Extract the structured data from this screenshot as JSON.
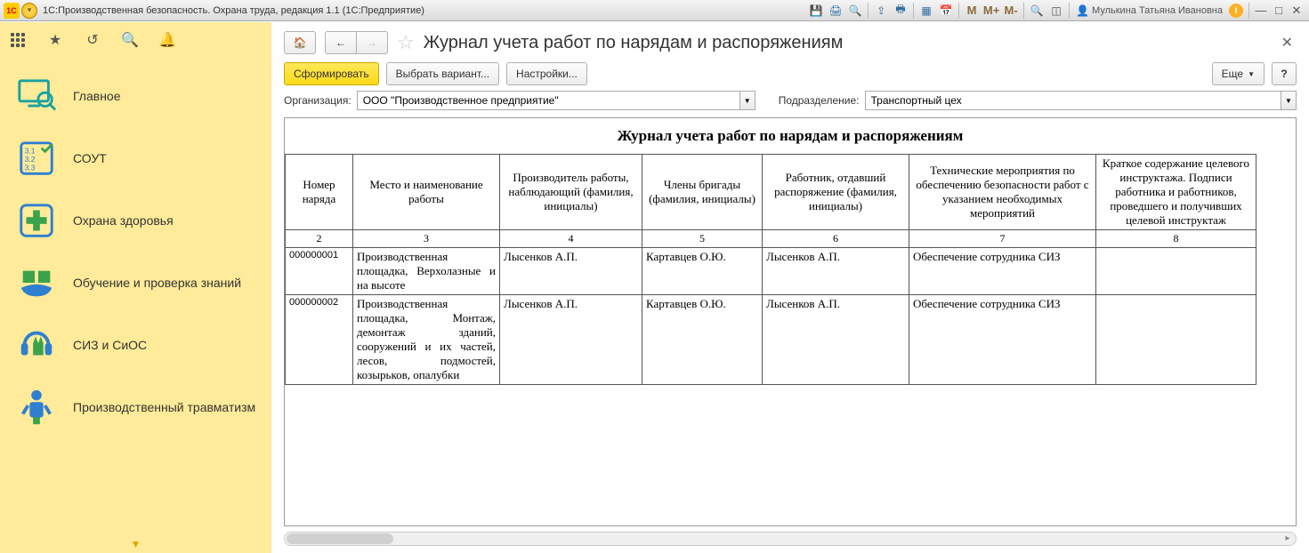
{
  "titlebar": {
    "app_title": "1С:Производственная безопасность. Охрана труда, редакция 1.1  (1С:Предприятие)",
    "user_name": "Мулькина Татьяна Ивановна"
  },
  "sidebar": {
    "items": [
      {
        "label": "Главное"
      },
      {
        "label": "СОУТ"
      },
      {
        "label": "Охрана здоровья"
      },
      {
        "label": "Обучение и проверка знаний"
      },
      {
        "label": "СИЗ и СиОС"
      },
      {
        "label": "Производственный травматизм"
      }
    ]
  },
  "page": {
    "title": "Журнал учета работ по нарядам и распоряжениям",
    "btn_form": "Сформировать",
    "btn_variant": "Выбрать вариант...",
    "btn_settings": "Настройки...",
    "btn_more": "Еще",
    "btn_help": "?",
    "lbl_org": "Организация:",
    "org_value": "ООО \"Производственное предприятие\"",
    "lbl_dep": "Подразделение:",
    "dep_value": "Транспортный цех"
  },
  "report": {
    "title": "Журнал учета работ по нарядам и распоряжениям",
    "headers": [
      "Номер наряда",
      "Место и наименование работы",
      "Производитель работы, наблюдающий (фамилия, инициалы)",
      "Члены бригады (фамилия, инициалы)",
      "Работник, отдавший распоряжение (фамилия, инициалы)",
      "Технические мероприятия по обеспечению безопасности работ с указанием необходимых мероприятий",
      "Краткое содержание целевого инструктажа. Подписи работника и работников, проведшего и получивших целевой инструктаж"
    ],
    "numrow": [
      "2",
      "3",
      "4",
      "5",
      "6",
      "7",
      "8"
    ],
    "rows": [
      {
        "num": "000000001",
        "place": "Производственная площадка, Верхолазные и на высоте",
        "producer": "Лысенков А.П.",
        "brigade": "Картавцев О.Ю.",
        "ordered": "Лысенков А.П.",
        "tech": "Обеспечение сотрудника СИЗ",
        "brief": ""
      },
      {
        "num": "000000002",
        "place": "Производственная площадка, Монтаж, демонтаж зданий, сооружений и их частей, лесов, подмостей, козырьков, опалубки",
        "producer": "Лысенков А.П.",
        "brigade": "Картавцев О.Ю.",
        "ordered": "Лысенков А.П.",
        "tech": "Обеспечение сотрудника СИЗ",
        "brief": ""
      }
    ]
  }
}
